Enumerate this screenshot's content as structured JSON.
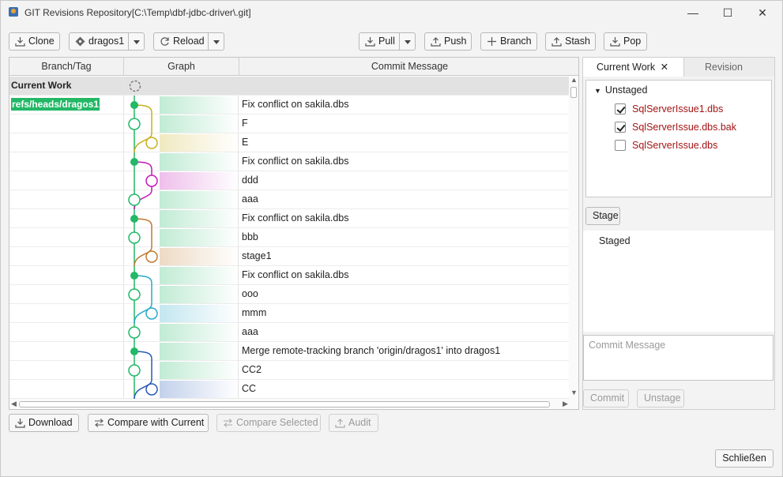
{
  "window": {
    "title": "GIT Revisions Repository[C:\\Temp\\dbf-jdbc-driver\\.git]",
    "minimize": "—",
    "maximize": "☐",
    "close": "✕"
  },
  "toolbar": {
    "clone": "Clone",
    "branch_select": "dragos1",
    "reload": "Reload",
    "pull": "Pull",
    "push": "Push",
    "branch": "Branch",
    "stash": "Stash",
    "pop": "Pop"
  },
  "grid": {
    "columns": [
      "Branch/Tag",
      "Graph",
      "Commit Message"
    ],
    "current_work": "Current Work",
    "rows": [
      {
        "branch": "refs/heads/dragos1",
        "message": "Fix conflict on sakila.dbs"
      },
      {
        "branch": "",
        "message": "F"
      },
      {
        "branch": "",
        "message": "E"
      },
      {
        "branch": "",
        "message": "Fix conflict on sakila.dbs"
      },
      {
        "branch": "",
        "message": "ddd"
      },
      {
        "branch": "",
        "message": "aaa"
      },
      {
        "branch": "",
        "message": "Fix conflict on sakila.dbs"
      },
      {
        "branch": "",
        "message": "bbb"
      },
      {
        "branch": "",
        "message": "stage1"
      },
      {
        "branch": "",
        "message": "Fix conflict on sakila.dbs"
      },
      {
        "branch": "",
        "message": "ooo"
      },
      {
        "branch": "",
        "message": "mmm"
      },
      {
        "branch": "",
        "message": "aaa"
      },
      {
        "branch": "",
        "message": "Merge remote-tracking branch 'origin/dragos1' into dragos1"
      },
      {
        "branch": "",
        "message": "CC2"
      },
      {
        "branch": "",
        "message": "CC"
      }
    ]
  },
  "bottom": {
    "download": "Download",
    "compare_current": "Compare with Current",
    "compare_selected": "Compare Selected",
    "audit": "Audit",
    "close": "Schließen"
  },
  "side": {
    "tab_current": "Current Work",
    "tab_close": "✕",
    "tab_revision": "Revision",
    "unstaged_label": "Unstaged",
    "files": [
      {
        "name": "SqlServerIssue1.dbs",
        "checked": true
      },
      {
        "name": "SqlServerIssue.dbs.bak",
        "checked": true
      },
      {
        "name": "SqlServerIssue.dbs",
        "checked": false
      }
    ],
    "stage": "Stage",
    "staged_label": "Staged",
    "commit_placeholder": "Commit Message",
    "commit": "Commit",
    "unstage": "Unstage"
  },
  "colors": {
    "branch_tag": "#22b866",
    "file_modified": "#a31515",
    "lane_green": "#22b866",
    "lane_yellow": "#c8b01c",
    "lane_magenta": "#c41ab8",
    "lane_orange": "#c07a30",
    "lane_cyan": "#2aa8c8",
    "lane_blue": "#2a5ab8"
  }
}
